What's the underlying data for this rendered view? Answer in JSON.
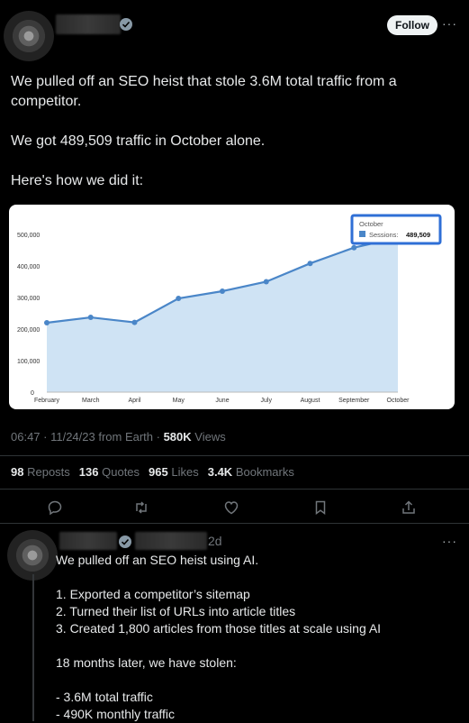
{
  "header": {
    "follow_label": "Follow",
    "more_label": "···"
  },
  "tweet": {
    "paragraphs": [
      "We pulled off an SEO heist that stole 3.6M total traffic from a competitor.",
      "We got 489,509 traffic in October alone.",
      "Here's how we did it:"
    ],
    "meta": {
      "time": "06:47 · 11/24/23 from Earth · ",
      "views_count": "580K",
      "views_label": " Views"
    },
    "stats": [
      {
        "count": "98",
        "label": "Reposts"
      },
      {
        "count": "136",
        "label": "Quotes"
      },
      {
        "count": "965",
        "label": "Likes"
      },
      {
        "count": "3.4K",
        "label": "Bookmarks"
      }
    ],
    "actions": [
      "reply-icon",
      "repost-icon",
      "like-icon",
      "bookmark-icon",
      "share-icon"
    ]
  },
  "chart_data": {
    "type": "area",
    "x": [
      "February",
      "March",
      "April",
      "May",
      "June",
      "July",
      "August",
      "September",
      "October"
    ],
    "series": [
      {
        "name": "Sessions",
        "values": [
          220000,
          237000,
          221000,
          297000,
          320000,
          350000,
          408000,
          458000,
          489509
        ]
      }
    ],
    "ylim": [
      0,
      500000
    ],
    "yticks": [
      "0",
      "100,000",
      "200,000",
      "300,000",
      "400,000",
      "500,000"
    ],
    "tooltip": {
      "title": "October",
      "series_label": "Sessions:",
      "value": "489,509"
    },
    "colors": {
      "line": "#4a86c8",
      "fill": "#cfe3f4",
      "tooltip_border": "#2f6fd6"
    }
  },
  "reply": {
    "time": "2d",
    "more_label": "···",
    "lines": [
      "We pulled off an SEO heist using AI.",
      "",
      "1. Exported a competitor’s sitemap",
      "2. Turned their list of URLs into article titles",
      "3. Created 1,800 articles from those titles at scale using AI",
      "",
      "18 months later, we have stolen:",
      "",
      "- 3.6M total traffic",
      "- 490K monthly traffic"
    ]
  }
}
